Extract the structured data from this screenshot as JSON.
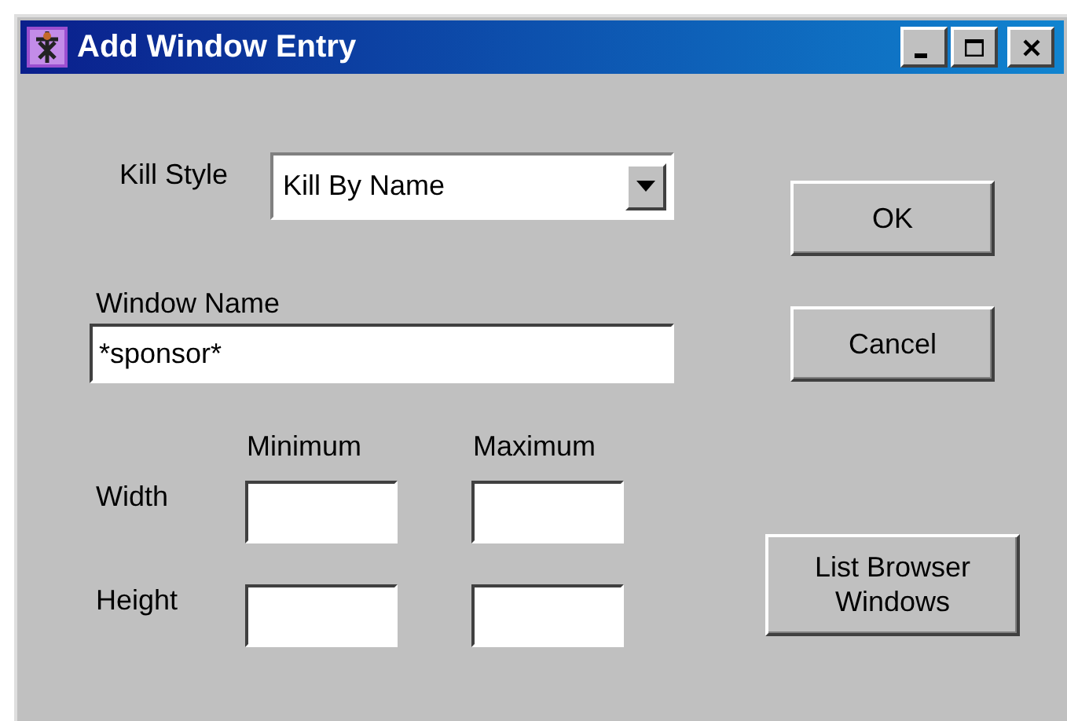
{
  "window": {
    "title": "Add Window Entry",
    "controls": [
      {
        "kind": "minimize"
      },
      {
        "kind": "maximize"
      },
      {
        "kind": "close"
      }
    ]
  },
  "kill_style": {
    "label": "Kill Style",
    "value": "Kill By Name"
  },
  "window_name": {
    "label": "Window Name",
    "value": "*sponsor*"
  },
  "size": {
    "columns": [
      "Minimum",
      "Maximum"
    ],
    "rows": [
      {
        "label": "Width"
      },
      {
        "label": "Height"
      }
    ]
  },
  "buttons": [
    "OK",
    "Cancel",
    "List Browser Windows"
  ]
}
